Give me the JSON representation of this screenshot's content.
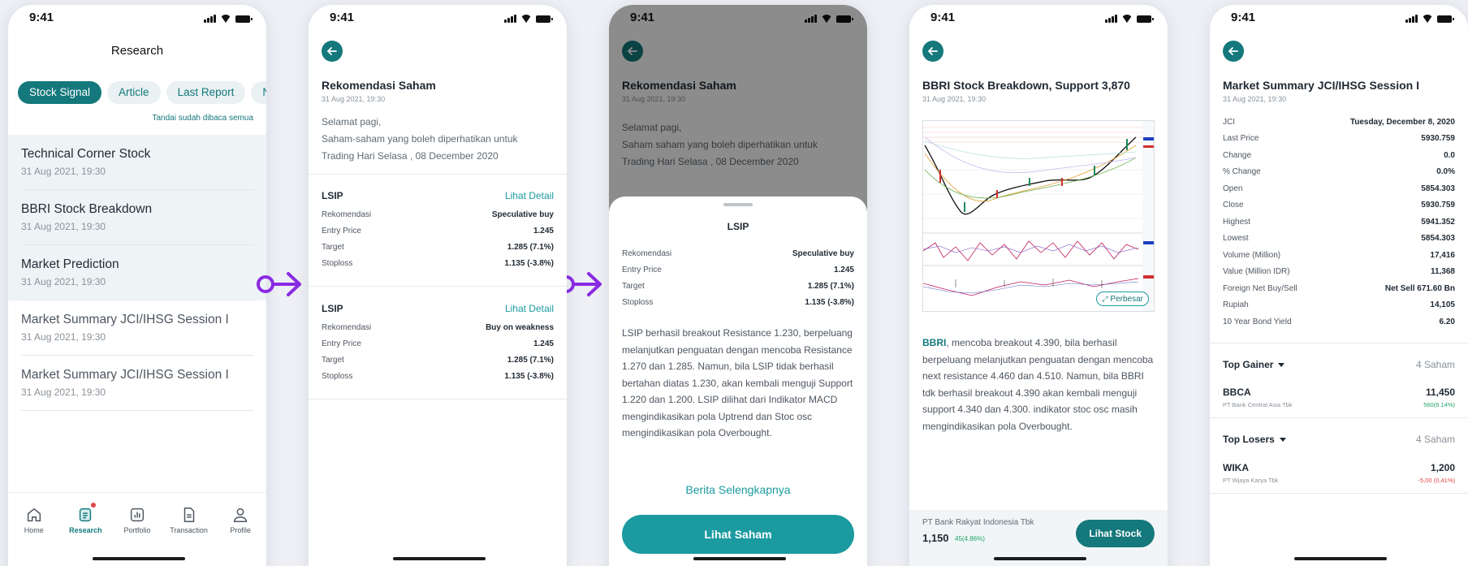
{
  "status": {
    "time": "9:41"
  },
  "screen1": {
    "title": "Research",
    "tabs": [
      "Stock Signal",
      "Article",
      "Last Report",
      "N"
    ],
    "mark_all": "Tandai sudah dibaca semua",
    "notifications": [
      {
        "title": "Technical Corner Stock",
        "date": "31 Aug 2021, 19:30",
        "unread": true
      },
      {
        "title": "BBRI Stock Breakdown",
        "date": "31 Aug 2021, 19:30",
        "unread": true
      },
      {
        "title": "Market Prediction",
        "date": "31 Aug 2021, 19:30",
        "unread": true
      },
      {
        "title": "Market Summary JCI/IHSG Session I",
        "date": "31 Aug 2021, 19:30",
        "unread": false
      },
      {
        "title": "Market Summary JCI/IHSG Session I",
        "date": "31 Aug 2021, 19:30",
        "unread": false
      }
    ],
    "nav": [
      {
        "label": "Home",
        "icon": "home-icon"
      },
      {
        "label": "Research",
        "icon": "research-icon",
        "active": true
      },
      {
        "label": "Portfolio",
        "icon": "portfolio-icon"
      },
      {
        "label": "Transaction",
        "icon": "transaction-icon"
      },
      {
        "label": "Profile",
        "icon": "profile-icon"
      }
    ]
  },
  "screen2": {
    "title": "Rekomendasi Saham",
    "date": "31 Aug 2021, 19:30",
    "intro": [
      "Selamat pagi,",
      "Saham-saham yang boleh diperhatikan untuk",
      "Trading Hari Selasa , 08 December 2020"
    ],
    "detail_link": "Lihat Detail",
    "cards": [
      {
        "ticker": "LSIP",
        "rows": [
          [
            "Rekomendasi",
            "Speculative buy"
          ],
          [
            "Entry Price",
            "1.245"
          ],
          [
            "Target",
            "1.285 (7.1%)"
          ],
          [
            "Stoploss",
            "1.135 (-3.8%)"
          ]
        ]
      },
      {
        "ticker": "LSIP",
        "rows": [
          [
            "Rekomendasi",
            "Buy on weakness"
          ],
          [
            "Entry Price",
            "1.245"
          ],
          [
            "Target",
            "1.285 (7.1%)"
          ],
          [
            "Stoploss",
            "1.135 (-3.8%)"
          ]
        ]
      }
    ]
  },
  "screen3": {
    "title": "Rekomendasi Saham",
    "date": "31 Aug 2021, 19:30",
    "intro": [
      "Selamat pagi,",
      "Saham saham yang boleh diperhatikan untuk",
      "Trading Hari Selasa , 08 December 2020"
    ],
    "sheet_title": "LSIP",
    "rows": [
      [
        "Rekomendasi",
        "Speculative buy"
      ],
      [
        "Entry Price",
        "1.245"
      ],
      [
        "Target",
        "1.285 (7.1%)"
      ],
      [
        "Stoploss",
        "1.135 (-3.8%)"
      ]
    ],
    "body": "LSIP berhasil breakout Resistance 1.230, berpeluang melanjutkan penguatan dengan mencoba Resistance 1.270 dan 1.285. Namun, bila LSIP tidak berhasil bertahan diatas 1.230, akan kembali menguji Support 1.220 dan 1.200. LSIP dilihat dari Indikator MACD mengindikasikan pola Uptrend dan Stoc osc mengindikasikan pola Overbought.",
    "more_link": "Berita Selengkapnya",
    "cta": "Lihat Saham"
  },
  "screen4": {
    "title": "BBRI Stock Breakdown, Support 3,870",
    "date": "31 Aug 2021, 19:30",
    "enlarge": "Perbesar",
    "body_ticker": "BBRI",
    "body": ", mencoba breakout 4.390, bila berhasil berpeluang melanjutkan penguatan dengan mencoba next resistance 4.460 dan 4.510. Namun, bila BBRI tdk berhasil breakout 4.390 akan kembali menguji support 4.340 dan 4.300. indikator stoc osc masih mengindikasikan pola Overbought.",
    "company": "PT Bank Rakyat Indonesia Tbk",
    "price": "1,150",
    "change": "45(4.86%)",
    "cta": "Lihat Stock"
  },
  "screen5": {
    "title": "Market Summary JCI/IHSG Session I",
    "date": "31 Aug 2021, 19:30",
    "rows": [
      [
        "JCI",
        "Tuesday, December 8, 2020"
      ],
      [
        "Last Price",
        "5930.759"
      ],
      [
        "Change",
        "0.0"
      ],
      [
        "% Change",
        "0.0%"
      ],
      [
        "Open",
        "5854.303"
      ],
      [
        "Close",
        "5930.759"
      ],
      [
        "Highest",
        "5941.352"
      ],
      [
        "Lowest",
        "5854.303"
      ],
      [
        "Volume (Million)",
        "17,416"
      ],
      [
        "Value (Million IDR)",
        "11,368"
      ],
      [
        "Foreign Net Buy/Sell",
        "Net Sell 671.60 Bn"
      ],
      [
        "Rupiah",
        "14,105"
      ],
      [
        "10 Year Bond Yield",
        "6.20"
      ]
    ],
    "gainer": {
      "label": "Top Gainer",
      "count": "4 Saham",
      "ticker": "BBCA",
      "name": "PT Bank Central Asia Tbk",
      "price": "11,450",
      "change": "560(6.14%)"
    },
    "loser": {
      "label": "Top Losers",
      "count": "4 Saham",
      "ticker": "WIKA",
      "name": "PT Wjaya Karya Tbk",
      "price": "1,200",
      "change": "-5,00 (0,41%)"
    }
  },
  "colors": {
    "primary": "#14787C",
    "accent": "#1B9AA0",
    "arrow": "#8A2BE2",
    "up": "#1FA36A",
    "down": "#E04444"
  }
}
